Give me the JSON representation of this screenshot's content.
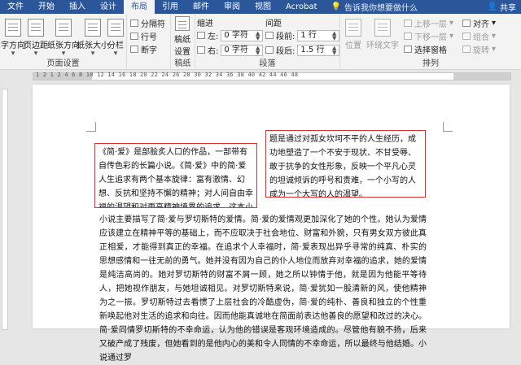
{
  "tabs": {
    "file": "文件",
    "items": [
      "开始",
      "插入",
      "设计",
      "布局",
      "引用",
      "邮件",
      "审阅",
      "视图",
      "Acrobat"
    ],
    "active_index": 3,
    "tell_me": "告诉我你想要做什么",
    "share": "共享"
  },
  "ribbon": {
    "page_setup": {
      "label": "页面设置",
      "text_direction": "字方向",
      "margins": "页边距",
      "orientation": "纸张方向",
      "size": "纸张大小",
      "columns": "分栏",
      "breaks": "分隔符",
      "line_numbers": "行号",
      "hyphenation": "断字"
    },
    "manuscript": {
      "label": "稿纸",
      "button_line1": "稿纸",
      "button_line2": "设置"
    },
    "indent": {
      "header": "缩进",
      "left_label": "左:",
      "left_value": "0 字符",
      "right_label": "右:",
      "right_value": "0 字符"
    },
    "spacing": {
      "header": "间距",
      "before_label": "段前:",
      "before_value": "1 行",
      "after_label": "段后:",
      "after_value": "1.5 行"
    },
    "paragraph_label": "段落",
    "arrange": {
      "label": "排列",
      "position": "位置",
      "wrap_text": "环绕文字",
      "bring_forward": "上移一层",
      "send_backward": "下移一层",
      "selection_pane": "选择窗格",
      "align": "对齐",
      "group": "组合",
      "rotate": "旋转"
    }
  },
  "ruler": {
    "numbers": "1 2 1 2 4 6 8 10 12 14 16 18 20 22 24 26 28 30 32 34 36 38 40 42 44 46 48"
  },
  "document": {
    "textbox1": "《简·爱》是部脍炙人口的作品，一部带有自传色彩的长篇小说。《简·爱》中的简·爱人生追求有两个基本旋律：富有激情、幻想、反抗和坚持不懈的精神；对人间自由幸福的渴望和对更高精神境界的追求。这本小说的主",
    "textbox2": "题是通过对孤女坎坷不平的人生经历，成功地塑造了一个不安于现状、不甘受辱、敢于抗争的女性形象，反映一个平凡心灵的坦诚倾诉的呼号和责难，一个小写的人成为一个大写的人的渴望。",
    "body": "小说主要描写了简·爱与罗切斯特的爱情。简·爱的爱情观更加深化了她的个性。她认为爱情应该建立在精神平等的基础上，而不应取决于社会地位、财富和外貌，只有男女双方彼此真正相爱，才能得到真正的幸福。在追求个人幸福时，简·爱表现出异乎寻常的纯真、朴实的思想感情和一往无前的勇气。她并没有因为自己的仆人地位而放弃对幸福的追求，她的爱情是纯洁高尚的。她对罗切斯特的财富不屑一顾，她之所以钟情于他，就是因为他能平等待人，把她视作朋友，与她坦诚相见。对罗切斯特来说，简·爱犹如一股清新的风，使他精神为之一振。罗切斯特过去看惯了上层社会的冷酷虚伪，简·爱的纯朴、善良和独立的个性重新唤起他对生活的追求和向往。因而他能真诚地在简面前表达他善良的愿望和改过的决心。简·爱同情罗切斯特的不幸命运，认为他的错误是客观环境造成的。尽管他有貌不扬，后来又破产成了残废，但她看到的是他内心的美和令人同情的不幸命运，所以最终与他结婚。小说通过罗"
  }
}
